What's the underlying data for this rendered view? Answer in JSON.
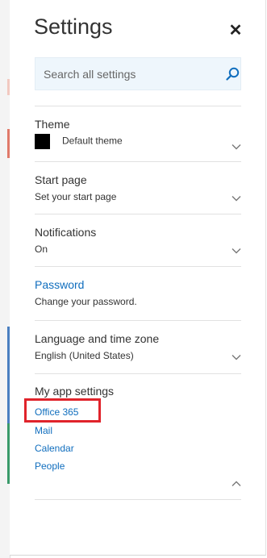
{
  "panel": {
    "title": "Settings",
    "close_icon": "close-icon"
  },
  "search": {
    "placeholder": "Search all settings",
    "value": "",
    "icon": "search-icon"
  },
  "sections": {
    "theme": {
      "title": "Theme",
      "value": "Default theme",
      "swatch_color": "#000000"
    },
    "start_page": {
      "title": "Start page",
      "subtitle": "Set your start page"
    },
    "notifications": {
      "title": "Notifications",
      "subtitle": "On"
    },
    "password": {
      "title": "Password",
      "subtitle": "Change your password."
    },
    "language": {
      "title": "Language and time zone",
      "subtitle": "English (United States)"
    },
    "my_app_settings": {
      "title": "My app settings",
      "links": [
        "Office 365",
        "Mail",
        "Calendar",
        "People"
      ]
    }
  },
  "colors": {
    "accent": "#106ebe",
    "highlight": "#e0232b",
    "search_bg": "#eef6fc"
  }
}
